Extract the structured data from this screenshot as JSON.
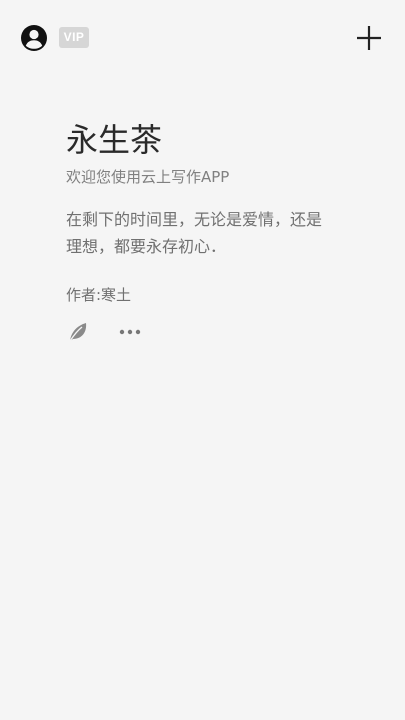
{
  "header": {
    "avatar_icon": "user-avatar-icon",
    "vip_label": "VIP",
    "add_icon": "plus-icon"
  },
  "main": {
    "title": "永生茶",
    "subtitle": "欢迎您使用云上写作APP",
    "quote": "在剩下的时间里，无论是爱情，还是理想，都要永存初心．",
    "author": "作者:寒土",
    "actions": {
      "leaf_icon": "leaf-icon",
      "more_icon": "more-dots-icon"
    }
  },
  "colors": {
    "background": "#f5f5f5",
    "title": "#2a2a2a",
    "body_text": "#707070",
    "vip_badge": "#d6d6d6"
  }
}
